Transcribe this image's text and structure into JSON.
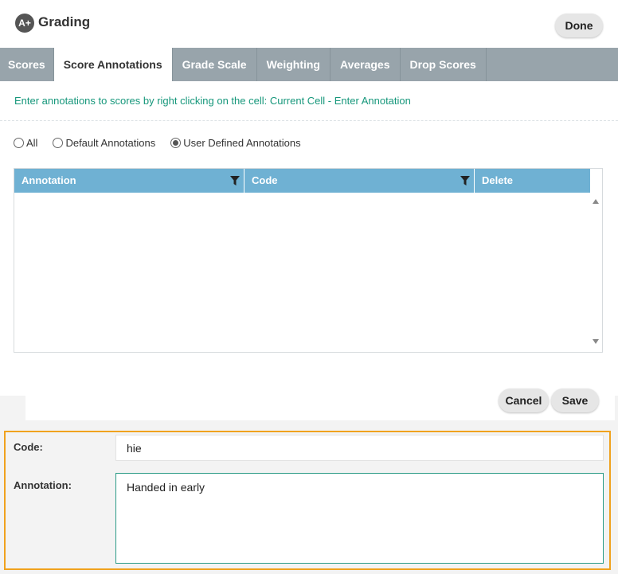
{
  "header": {
    "logo_text": "A+",
    "title": "Grading",
    "done_label": "Done"
  },
  "tabs": [
    {
      "label": "Scores",
      "active": false
    },
    {
      "label": "Score Annotations",
      "active": true
    },
    {
      "label": "Grade Scale",
      "active": false
    },
    {
      "label": "Weighting",
      "active": false
    },
    {
      "label": "Averages",
      "active": false
    },
    {
      "label": "Drop Scores",
      "active": false
    }
  ],
  "hint": "Enter annotations to scores by right clicking on the cell: Current Cell - Enter Annotation",
  "filter": {
    "options": [
      {
        "label": "All",
        "checked": false
      },
      {
        "label": "Default Annotations",
        "checked": false
      },
      {
        "label": "User Defined Annotations",
        "checked": true
      }
    ]
  },
  "grid": {
    "columns": [
      {
        "label": "Annotation",
        "filterable": true
      },
      {
        "label": "Code",
        "filterable": true
      },
      {
        "label": "Delete",
        "filterable": false
      }
    ],
    "rows": []
  },
  "actions": {
    "cancel_label": "Cancel",
    "save_label": "Save"
  },
  "editor": {
    "code_label": "Code:",
    "code_value": "hie",
    "annotation_label": "Annotation:",
    "annotation_value": "Handed in early"
  },
  "colors": {
    "tab_bar": "#98a4ab",
    "grid_header": "#6fb1d3",
    "hint_text": "#16977b",
    "panel_highlight": "#f0a21e",
    "textarea_focus": "#2a9b86"
  },
  "icons": {
    "column_filter": "filter-icon",
    "scroll_up": "scroll-up-arrow-icon",
    "scroll_down": "scroll-down-arrow-icon"
  }
}
